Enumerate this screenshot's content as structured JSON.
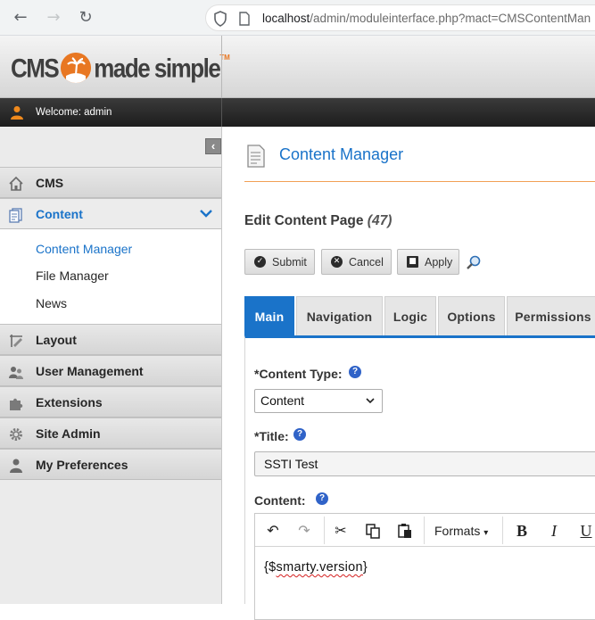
{
  "browser": {
    "url_host": "localhost",
    "url_path": "/admin/moduleinterface.php?mact=CMSContentMan"
  },
  "header": {
    "logo_left": "CMS",
    "logo_right": "made simple",
    "logo_tm": "TM"
  },
  "welcome": {
    "text": "Welcome: admin"
  },
  "sidebar": {
    "sections": [
      {
        "label": "CMS",
        "icon": "home-icon"
      },
      {
        "label": "Content",
        "icon": "content-icon"
      },
      {
        "label": "Layout",
        "icon": "layout-icon"
      },
      {
        "label": "User Management",
        "icon": "users-icon"
      },
      {
        "label": "Extensions",
        "icon": "puzzle-icon"
      },
      {
        "label": "Site Admin",
        "icon": "gear-icon"
      },
      {
        "label": "My Preferences",
        "icon": "user-icon"
      }
    ],
    "content_items": [
      {
        "label": "Content Manager"
      },
      {
        "label": "File Manager"
      },
      {
        "label": "News"
      }
    ]
  },
  "main": {
    "page_title": "Content Manager",
    "edit_title": "Edit Content Page",
    "edit_id": "(47)",
    "buttons": {
      "submit": "Submit",
      "cancel": "Cancel",
      "apply": "Apply"
    },
    "tabs": [
      {
        "label": "Main"
      },
      {
        "label": "Navigation"
      },
      {
        "label": "Logic"
      },
      {
        "label": "Options"
      },
      {
        "label": "Permissions"
      }
    ],
    "content_type": {
      "label": "*Content Type:",
      "value": "Content"
    },
    "title_field": {
      "label": "*Title:",
      "value": "SSTI Test"
    },
    "content_field": {
      "label": "Content:"
    },
    "editor": {
      "formats_label": "Formats",
      "bold": "B",
      "italic": "I",
      "underline": "U",
      "text_prefix": "{$",
      "text_middle": "smarty.version",
      "text_suffix": "}"
    }
  },
  "colors": {
    "accent": "#1a73c9",
    "brand": "#e87722"
  }
}
